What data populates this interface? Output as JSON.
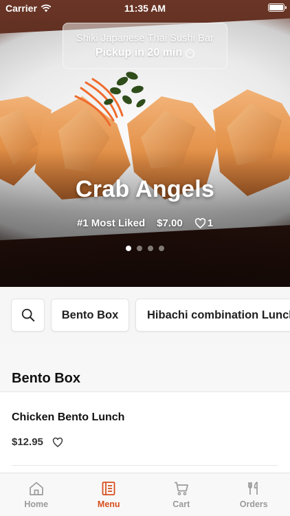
{
  "status_bar": {
    "carrier": "Carrier",
    "time": "11:35 AM"
  },
  "store": {
    "name": "Shiki Japanese Thai Sushi Bar",
    "pickup": "Pickup in 20 min"
  },
  "featured": {
    "title": "Crab Angels",
    "rank": "#1 Most Liked",
    "price": "$7.00",
    "likes": "1",
    "carousel": {
      "count": 4,
      "active_index": 0
    }
  },
  "categories": [
    {
      "label": "Bento Box"
    },
    {
      "label": "Hibachi combination Lunch"
    }
  ],
  "menu": {
    "section_title": "Bento Box",
    "items": [
      {
        "name": "Chicken Bento Lunch",
        "price": "$12.95"
      }
    ]
  },
  "tabs": [
    {
      "label": "Home",
      "icon": "home-icon",
      "active": false
    },
    {
      "label": "Menu",
      "icon": "menu-icon",
      "active": true
    },
    {
      "label": "Cart",
      "icon": "cart-icon",
      "active": false
    },
    {
      "label": "Orders",
      "icon": "orders-icon",
      "active": false
    }
  ],
  "colors": {
    "accent": "#d84e1d",
    "inactive_tab": "#9a9a9a",
    "background": "#f7f7f7"
  }
}
